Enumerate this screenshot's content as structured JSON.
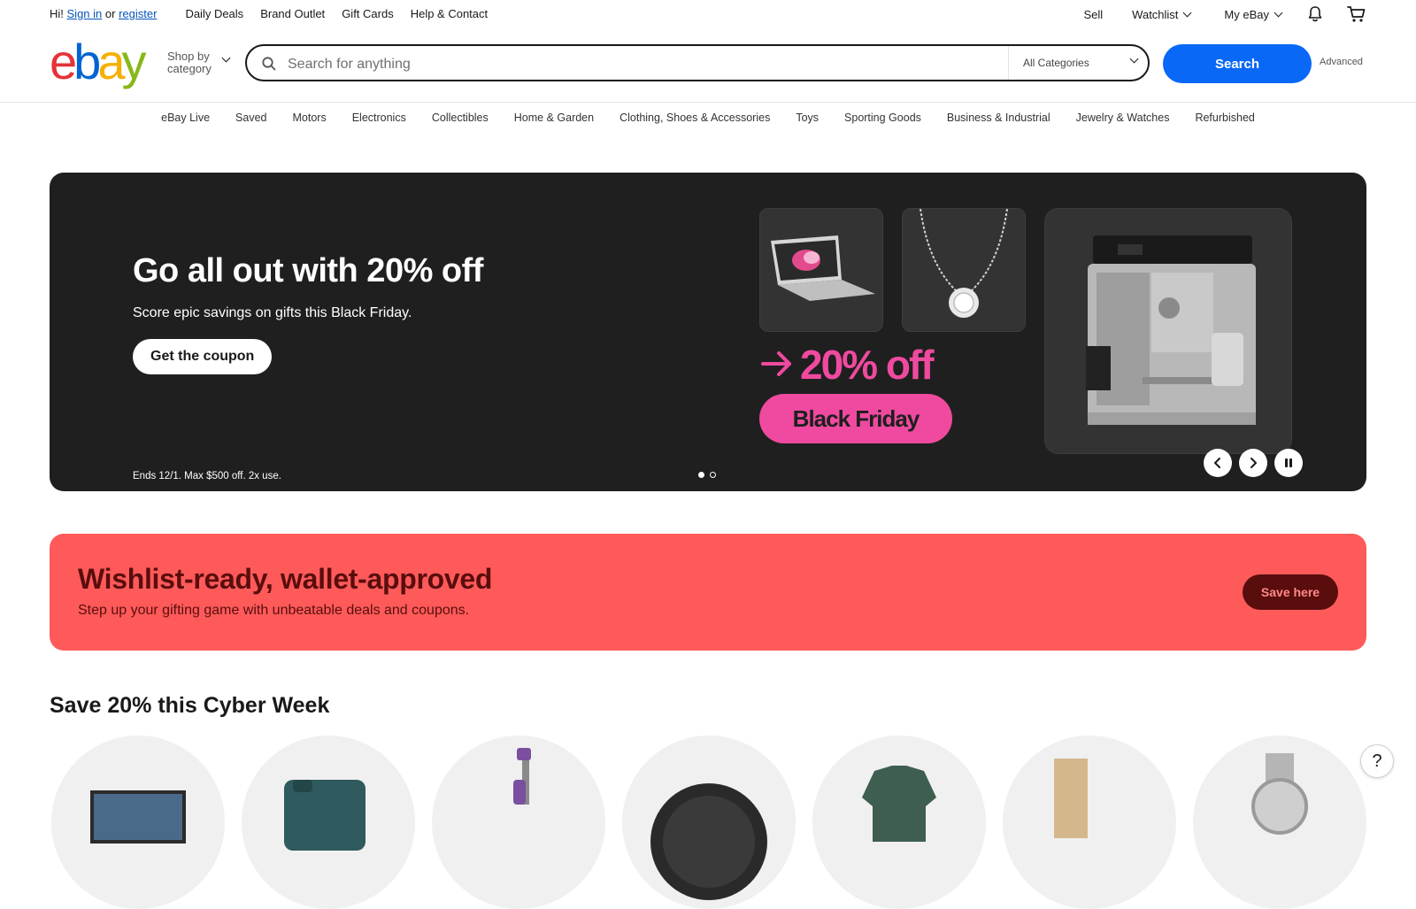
{
  "topbar": {
    "greeting_prefix": "Hi!",
    "sign_in": "Sign in",
    "or": "or",
    "register": "register",
    "links": [
      "Daily Deals",
      "Brand Outlet",
      "Gift Cards",
      "Help & Contact"
    ],
    "sell": "Sell",
    "watchlist": "Watchlist",
    "my_ebay": "My eBay"
  },
  "header": {
    "logo_letters": [
      "e",
      "b",
      "a",
      "y"
    ],
    "logo_colors": [
      "#e53238",
      "#0064d2",
      "#f5af02",
      "#86b817"
    ],
    "shop_by_line1": "Shop by",
    "shop_by_line2": "category",
    "search_placeholder": "Search for anything",
    "category_selected": "All Categories",
    "search_button": "Search",
    "advanced": "Advanced"
  },
  "catnav": [
    "eBay Live",
    "Saved",
    "Motors",
    "Electronics",
    "Collectibles",
    "Home & Garden",
    "Clothing, Shoes & Accessories",
    "Toys",
    "Sporting Goods",
    "Business & Industrial",
    "Jewelry & Watches",
    "Refurbished"
  ],
  "hero": {
    "title": "Go all out with 20% off",
    "subtitle": "Score epic savings on gifts this Black Friday.",
    "cta": "Get the coupon",
    "fine_print": "Ends 12/1. Max $500 off. 2x use.",
    "promo_text": "20% off",
    "promo_pill": "Black Friday",
    "slide_count": 2,
    "active_slide": 1
  },
  "banner": {
    "title": "Wishlist-ready, wallet-approved",
    "subtitle": "Step up your gifting game with unbeatable deals and coupons.",
    "button": "Save here"
  },
  "cyber_week": {
    "title": "Save 20% this Cyber Week"
  },
  "help_label": "?",
  "colors": {
    "search_blue": "#0968f6",
    "hero_bg": "#1f1f1f",
    "promo_pink": "#ef4a9f",
    "banner_bg": "#ff5a5a",
    "banner_dark": "#5a0d0d"
  }
}
